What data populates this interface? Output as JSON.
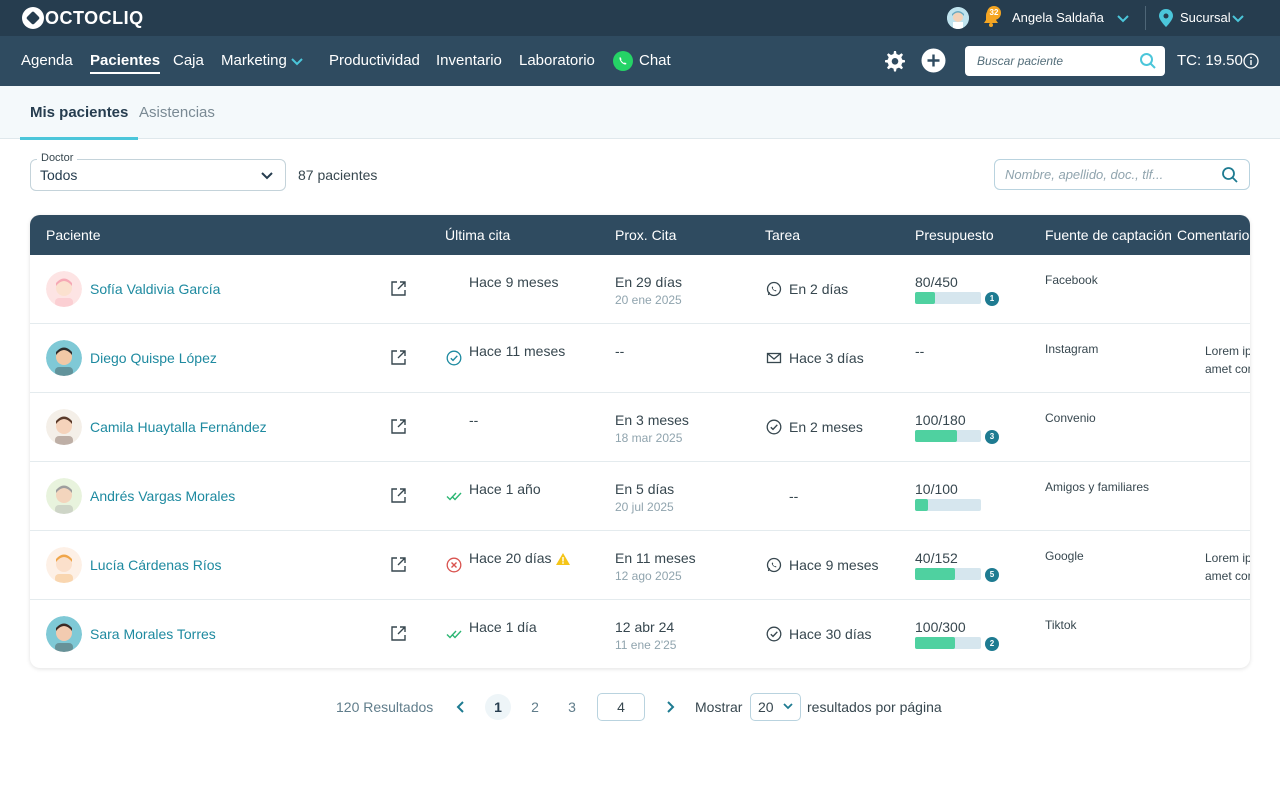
{
  "app": {
    "brand": "OCTOCLIQ"
  },
  "topbar": {
    "notifications": "32",
    "user_name": "Angela Saldaña",
    "branch": "Sucursal"
  },
  "nav": {
    "items": [
      {
        "label": "Agenda",
        "active": false
      },
      {
        "label": "Pacientes",
        "active": true
      },
      {
        "label": "Caja",
        "active": false
      },
      {
        "label": "Marketing",
        "active": false
      },
      {
        "label": "Productividad",
        "active": false
      },
      {
        "label": "Inventario",
        "active": false
      },
      {
        "label": "Laboratorio",
        "active": false
      },
      {
        "label": "Chat",
        "active": false
      }
    ],
    "search_placeholder": "Buscar paciente",
    "tc": "TC: 19.50"
  },
  "tabs": [
    {
      "label": "Mis pacientes",
      "active": true
    },
    {
      "label": "Asistencias",
      "active": false
    }
  ],
  "filters": {
    "doctor_label": "Doctor",
    "doctor_value": "Todos",
    "count": "87 pacientes",
    "search_placeholder": "Nombre, apellido, doc., tlf..."
  },
  "table": {
    "columns": [
      "Paciente",
      "Última cita",
      "Prox. Cita",
      "Tarea",
      "Presupuesto",
      "Fuente de captación",
      "Comentario"
    ],
    "rows": [
      {
        "name": "Sofía Valdivia García",
        "last_icon": "",
        "last": "Hace 9 meses",
        "next": "En 29 días",
        "next_sub": "20 ene 2025",
        "task_icon": "whatsapp-icon",
        "task": "En 2 días",
        "budget": "80/450",
        "budget_fraction": 0.3,
        "budget_badge": "1",
        "source": "Facebook",
        "comment": [
          "",
          ""
        ]
      },
      {
        "name": "Diego Quispe López",
        "last_icon": "check-circle-icon",
        "last": "Hace 11 meses",
        "next": "--",
        "next_sub": "",
        "task_icon": "mail-icon",
        "task": "Hace 3 días",
        "budget": "--",
        "budget_fraction": null,
        "budget_badge": "",
        "source": "Instagram",
        "comment": [
          "Lorem ipsum dolor sit",
          "amet consectetur"
        ]
      },
      {
        "name": "Camila Huaytalla Fernández",
        "last_icon": "",
        "last": "--",
        "next": "En 3 meses",
        "next_sub": "18 mar 2025",
        "task_icon": "check-circle-icon",
        "task": "En 2 meses",
        "budget": "100/180",
        "budget_fraction": 0.63,
        "budget_badge": "3",
        "source": "Convenio",
        "comment": [
          "",
          ""
        ]
      },
      {
        "name": "Andrés Vargas Morales",
        "last_icon": "double-check-icon",
        "last": "Hace 1 año",
        "next": "En 5 días",
        "next_sub": "20 jul 2025",
        "task_icon": "",
        "task": "--",
        "budget": "10/100",
        "budget_fraction": 0.2,
        "budget_badge": "",
        "source": "Amigos y familiares",
        "comment": [
          "",
          ""
        ]
      },
      {
        "name": "Lucía Cárdenas Ríos",
        "last_icon": "cancel-circle-icon",
        "last": "Hace 20 días",
        "last_warning": true,
        "next": "En 11 meses",
        "next_sub": "12 ago 2025",
        "task_icon": "whatsapp-icon",
        "task": "Hace 9 meses",
        "budget": "40/152",
        "budget_fraction": 0.6,
        "budget_badge": "5",
        "source": "Google",
        "comment": [
          "Lorem ipsum dolor sit",
          "amet consectetur"
        ]
      },
      {
        "name": "Sara Morales Torres",
        "last_icon": "double-check-icon",
        "last": "Hace 1 día",
        "next": "12 abr 24",
        "next_sub": "11 ene 2'25",
        "task_icon": "check-circle-icon",
        "task": "Hace 30 días",
        "budget": "100/300",
        "budget_fraction": 0.6,
        "budget_badge": "2",
        "source": "Tiktok",
        "comment": [
          "",
          ""
        ]
      }
    ]
  },
  "pagination": {
    "results": "120 Resultados",
    "pages": [
      "1",
      "2",
      "3"
    ],
    "current": "1",
    "input_value": "4",
    "show_label": "Mostrar",
    "per_page": "20",
    "per_page_suffix": "resultados por página"
  },
  "colors": {
    "topbar": "#263d4f",
    "navbar": "#2f4b60",
    "link": "#1e8aa0",
    "accent": "#4bc6da",
    "progress": "#4fd1a0"
  }
}
